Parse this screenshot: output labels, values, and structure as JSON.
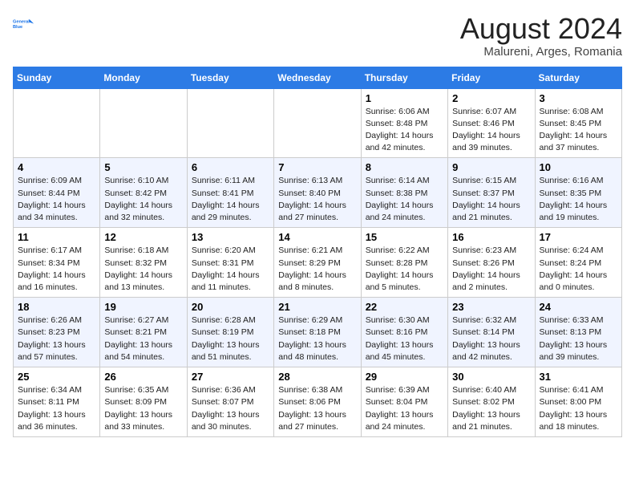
{
  "header": {
    "logo_line1": "General",
    "logo_line2": "Blue",
    "main_title": "August 2024",
    "subtitle": "Malureni, Arges, Romania"
  },
  "days_of_week": [
    "Sunday",
    "Monday",
    "Tuesday",
    "Wednesday",
    "Thursday",
    "Friday",
    "Saturday"
  ],
  "weeks": [
    [
      {
        "day": "",
        "info": ""
      },
      {
        "day": "",
        "info": ""
      },
      {
        "day": "",
        "info": ""
      },
      {
        "day": "",
        "info": ""
      },
      {
        "day": "1",
        "info": "Sunrise: 6:06 AM\nSunset: 8:48 PM\nDaylight: 14 hours\nand 42 minutes."
      },
      {
        "day": "2",
        "info": "Sunrise: 6:07 AM\nSunset: 8:46 PM\nDaylight: 14 hours\nand 39 minutes."
      },
      {
        "day": "3",
        "info": "Sunrise: 6:08 AM\nSunset: 8:45 PM\nDaylight: 14 hours\nand 37 minutes."
      }
    ],
    [
      {
        "day": "4",
        "info": "Sunrise: 6:09 AM\nSunset: 8:44 PM\nDaylight: 14 hours\nand 34 minutes."
      },
      {
        "day": "5",
        "info": "Sunrise: 6:10 AM\nSunset: 8:42 PM\nDaylight: 14 hours\nand 32 minutes."
      },
      {
        "day": "6",
        "info": "Sunrise: 6:11 AM\nSunset: 8:41 PM\nDaylight: 14 hours\nand 29 minutes."
      },
      {
        "day": "7",
        "info": "Sunrise: 6:13 AM\nSunset: 8:40 PM\nDaylight: 14 hours\nand 27 minutes."
      },
      {
        "day": "8",
        "info": "Sunrise: 6:14 AM\nSunset: 8:38 PM\nDaylight: 14 hours\nand 24 minutes."
      },
      {
        "day": "9",
        "info": "Sunrise: 6:15 AM\nSunset: 8:37 PM\nDaylight: 14 hours\nand 21 minutes."
      },
      {
        "day": "10",
        "info": "Sunrise: 6:16 AM\nSunset: 8:35 PM\nDaylight: 14 hours\nand 19 minutes."
      }
    ],
    [
      {
        "day": "11",
        "info": "Sunrise: 6:17 AM\nSunset: 8:34 PM\nDaylight: 14 hours\nand 16 minutes."
      },
      {
        "day": "12",
        "info": "Sunrise: 6:18 AM\nSunset: 8:32 PM\nDaylight: 14 hours\nand 13 minutes."
      },
      {
        "day": "13",
        "info": "Sunrise: 6:20 AM\nSunset: 8:31 PM\nDaylight: 14 hours\nand 11 minutes."
      },
      {
        "day": "14",
        "info": "Sunrise: 6:21 AM\nSunset: 8:29 PM\nDaylight: 14 hours\nand 8 minutes."
      },
      {
        "day": "15",
        "info": "Sunrise: 6:22 AM\nSunset: 8:28 PM\nDaylight: 14 hours\nand 5 minutes."
      },
      {
        "day": "16",
        "info": "Sunrise: 6:23 AM\nSunset: 8:26 PM\nDaylight: 14 hours\nand 2 minutes."
      },
      {
        "day": "17",
        "info": "Sunrise: 6:24 AM\nSunset: 8:24 PM\nDaylight: 14 hours\nand 0 minutes."
      }
    ],
    [
      {
        "day": "18",
        "info": "Sunrise: 6:26 AM\nSunset: 8:23 PM\nDaylight: 13 hours\nand 57 minutes."
      },
      {
        "day": "19",
        "info": "Sunrise: 6:27 AM\nSunset: 8:21 PM\nDaylight: 13 hours\nand 54 minutes."
      },
      {
        "day": "20",
        "info": "Sunrise: 6:28 AM\nSunset: 8:19 PM\nDaylight: 13 hours\nand 51 minutes."
      },
      {
        "day": "21",
        "info": "Sunrise: 6:29 AM\nSunset: 8:18 PM\nDaylight: 13 hours\nand 48 minutes."
      },
      {
        "day": "22",
        "info": "Sunrise: 6:30 AM\nSunset: 8:16 PM\nDaylight: 13 hours\nand 45 minutes."
      },
      {
        "day": "23",
        "info": "Sunrise: 6:32 AM\nSunset: 8:14 PM\nDaylight: 13 hours\nand 42 minutes."
      },
      {
        "day": "24",
        "info": "Sunrise: 6:33 AM\nSunset: 8:13 PM\nDaylight: 13 hours\nand 39 minutes."
      }
    ],
    [
      {
        "day": "25",
        "info": "Sunrise: 6:34 AM\nSunset: 8:11 PM\nDaylight: 13 hours\nand 36 minutes."
      },
      {
        "day": "26",
        "info": "Sunrise: 6:35 AM\nSunset: 8:09 PM\nDaylight: 13 hours\nand 33 minutes."
      },
      {
        "day": "27",
        "info": "Sunrise: 6:36 AM\nSunset: 8:07 PM\nDaylight: 13 hours\nand 30 minutes."
      },
      {
        "day": "28",
        "info": "Sunrise: 6:38 AM\nSunset: 8:06 PM\nDaylight: 13 hours\nand 27 minutes."
      },
      {
        "day": "29",
        "info": "Sunrise: 6:39 AM\nSunset: 8:04 PM\nDaylight: 13 hours\nand 24 minutes."
      },
      {
        "day": "30",
        "info": "Sunrise: 6:40 AM\nSunset: 8:02 PM\nDaylight: 13 hours\nand 21 minutes."
      },
      {
        "day": "31",
        "info": "Sunrise: 6:41 AM\nSunset: 8:00 PM\nDaylight: 13 hours\nand 18 minutes."
      }
    ]
  ]
}
